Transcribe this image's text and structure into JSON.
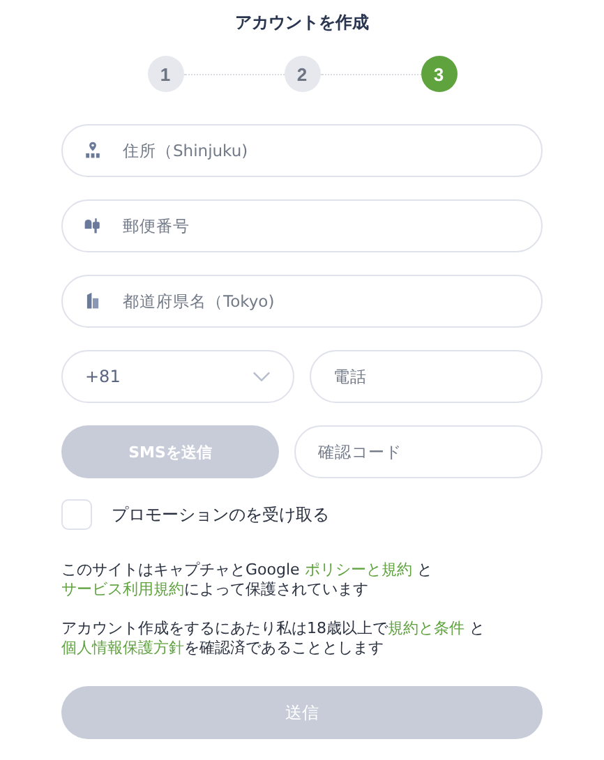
{
  "title": "アカウントを作成",
  "steps": [
    {
      "label": "1",
      "selected": false
    },
    {
      "label": "2",
      "selected": false
    },
    {
      "label": "3",
      "selected": true
    }
  ],
  "fields": [
    {
      "kind": "address",
      "placeholder": "住所（Shinjuku)"
    },
    {
      "kind": "postal",
      "placeholder": "郵便番号"
    },
    {
      "kind": "prefecture",
      "placeholder": "都道府県名（Tokyo)"
    }
  ],
  "phone": {
    "country_code": "+81",
    "placeholder": "電話"
  },
  "sms_button": {
    "label": "SMSを送信",
    "disabled": true
  },
  "code_field": {
    "placeholder": "確認コード"
  },
  "promo": {
    "label": "プロモーションのを受け取る",
    "checked": false
  },
  "notices": [
    {
      "lines": [
        [
          {
            "text": "このサイトはキャプチャとGoogle ",
            "link": false
          },
          {
            "text": "ポリシーと規約",
            "link": true
          },
          {
            "text": " と",
            "link": false
          }
        ],
        [
          {
            "text": "サービス利用規約",
            "link": true
          },
          {
            "text": "によって保護されています",
            "link": false
          }
        ]
      ]
    },
    {
      "lines": [
        [
          {
            "text": "アカウント作成をするにあたり私は18歳以上で",
            "link": false
          },
          {
            "text": "規約と条件",
            "link": true
          },
          {
            "text": " と",
            "link": false
          }
        ],
        [
          {
            "text": "個人情報保護方針",
            "link": true
          },
          {
            "text": "を確認済であることとします",
            "link": false
          }
        ]
      ]
    }
  ],
  "submit": {
    "label": "送信",
    "disabled": true
  }
}
